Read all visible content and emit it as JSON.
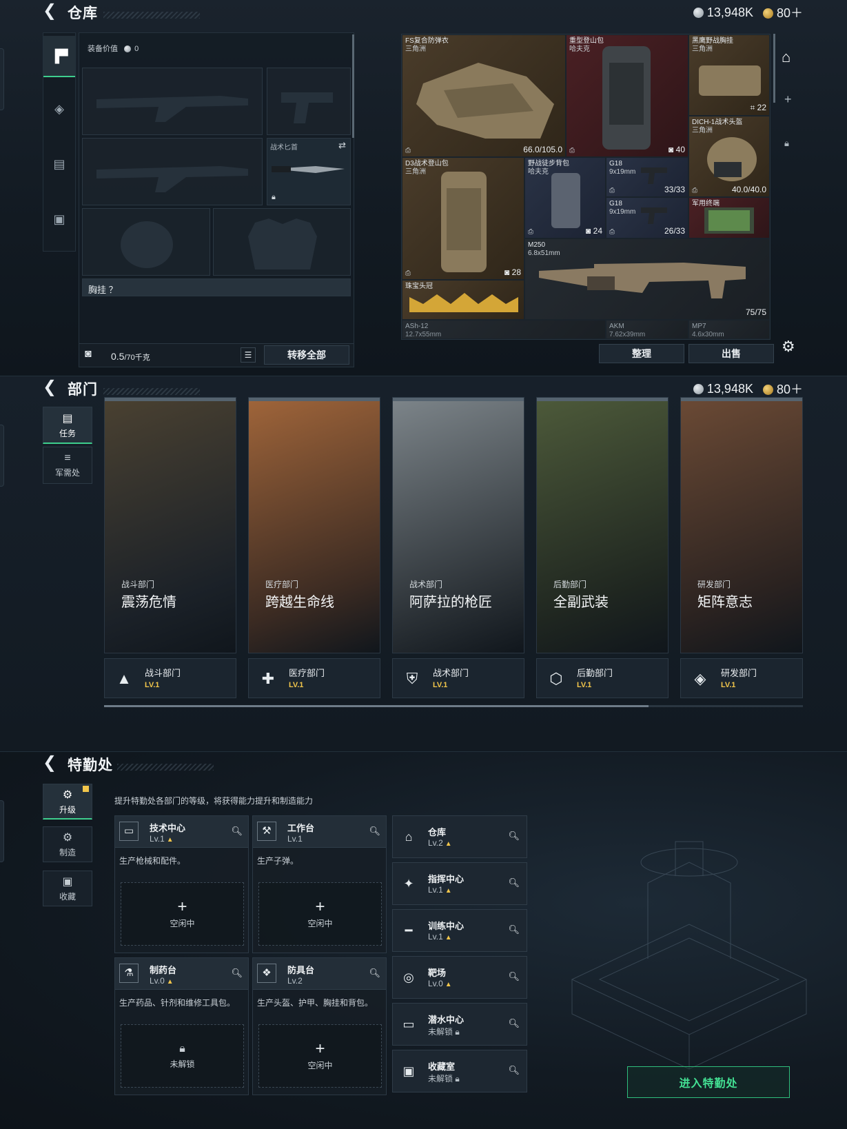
{
  "currency": {
    "silver": "13,948K",
    "gold": "80＋"
  },
  "s1": {
    "title": "仓库",
    "equip_value_label": "装备价值",
    "equip_value": "0",
    "knife_label": "战术匕首",
    "rig_label": "胸挂 ？",
    "weight": "0.5",
    "weight_max": "/70千克",
    "transfer_all": "转移全部",
    "sort": "整理",
    "sell": "出售",
    "items": [
      {
        "name": "FS复合防弹衣",
        "sub": "三角洲",
        "val": "66.0/105.0"
      },
      {
        "name": "重型登山包",
        "sub": "哈夫克",
        "val": "40"
      },
      {
        "name": "黑鹰野战胸挂",
        "sub": "三角洲",
        "val": "22"
      },
      {
        "name": "DICH-1战术头盔",
        "sub": "三角洲",
        "val": "40.0/40.0"
      },
      {
        "name": "D3战术登山包",
        "sub": "三角洲",
        "val": "28"
      },
      {
        "name": "野战徒步背包",
        "sub": "哈夫克",
        "val": "24"
      },
      {
        "name": "G18",
        "sub": "9x19mm",
        "val": "33/33"
      },
      {
        "name": "G18",
        "sub": "9x19mm",
        "val": "26/33"
      },
      {
        "name": "军用终端",
        "sub": "",
        "val": ""
      },
      {
        "name": "M250",
        "sub": "6.8x51mm",
        "val": "75/75"
      },
      {
        "name": "珠宝头冠",
        "sub": "",
        "val": ""
      },
      {
        "name": "ASh-12",
        "sub": "12.7x55mm",
        "val": ""
      },
      {
        "name": "AKM",
        "sub": "7.62x39mm",
        "val": ""
      },
      {
        "name": "MP7",
        "sub": "4.6x30mm",
        "val": ""
      }
    ]
  },
  "s2": {
    "title": "部门",
    "nav": [
      {
        "label": "任务"
      },
      {
        "label": "军需处"
      }
    ],
    "cards": [
      {
        "cat": "战斗部门",
        "name": "震荡危情",
        "dept": "战斗部门",
        "lv": "LV.1",
        "c1": "#4a4131",
        "c2": "#1b2128"
      },
      {
        "cat": "医疗部门",
        "name": "跨越生命线",
        "dept": "医疗部门",
        "lv": "LV.1",
        "c1": "#a0653a",
        "c2": "#3a2a22"
      },
      {
        "cat": "战术部门",
        "name": "阿萨拉的枪匠",
        "dept": "战术部门",
        "lv": "LV.1",
        "c1": "#7d858a",
        "c2": "#2b3136"
      },
      {
        "cat": "后勤部门",
        "name": "全副武装",
        "dept": "后勤部门",
        "lv": "LV.1",
        "c1": "#4d5a3a",
        "c2": "#1f2620"
      },
      {
        "cat": "研发部门",
        "name": "矩阵意志",
        "dept": "研发部门",
        "lv": "LV.1",
        "c1": "#6b4a35",
        "c2": "#2a2220"
      }
    ]
  },
  "s3": {
    "title": "特勤处",
    "nav": [
      {
        "label": "升级"
      },
      {
        "label": "制造"
      },
      {
        "label": "收藏"
      }
    ],
    "subtitle": "提升特勤处各部门的等级，将获得能力提升和制造能力",
    "facilities": [
      {
        "name": "技术中心",
        "lv": "Lv.1",
        "up": true,
        "desc": "生产枪械和配件。",
        "slot": "空闲中"
      },
      {
        "name": "工作台",
        "lv": "Lv.1",
        "up": false,
        "desc": "生产子弹。",
        "slot": "空闲中"
      },
      {
        "name": "制药台",
        "lv": "Lv.0",
        "up": true,
        "desc": "生产药品、针剂和维修工具包。",
        "slot": "未解锁"
      },
      {
        "name": "防具台",
        "lv": "Lv.2",
        "up": false,
        "desc": "生产头盔、护甲、胸挂和背包。",
        "slot": "空闲中"
      }
    ],
    "side": [
      {
        "name": "仓库",
        "lv": "Lv.2",
        "up": true
      },
      {
        "name": "指挥中心",
        "lv": "Lv.1",
        "up": true
      },
      {
        "name": "训练中心",
        "lv": "Lv.1",
        "up": true
      },
      {
        "name": "靶场",
        "lv": "Lv.0",
        "up": true
      },
      {
        "name": "潜水中心",
        "lv": "未解锁",
        "up": false
      },
      {
        "name": "收藏室",
        "lv": "未解锁",
        "up": false
      }
    ],
    "enter": "进入特勤处"
  }
}
